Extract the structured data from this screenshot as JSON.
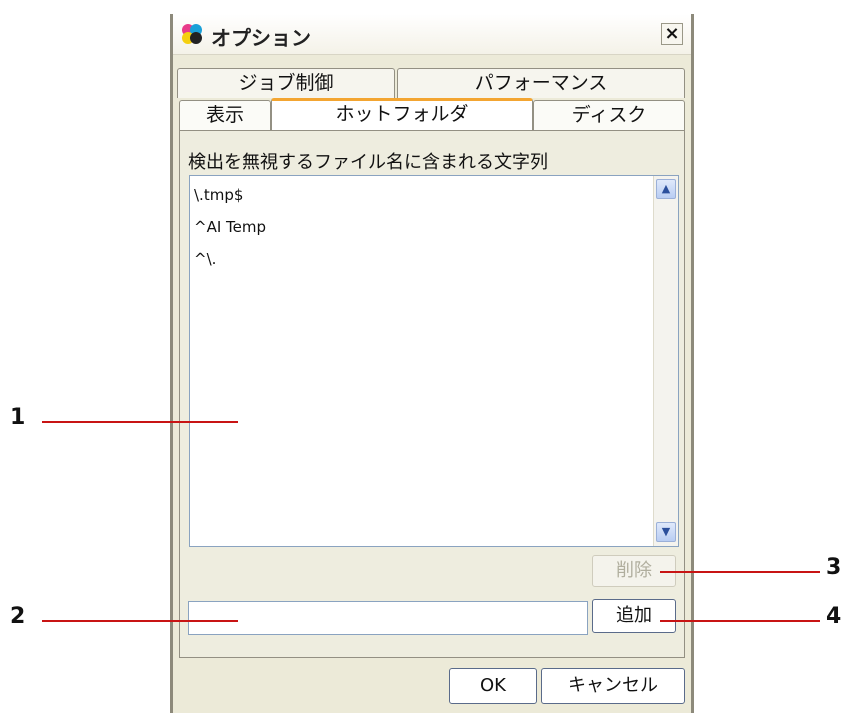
{
  "dialog": {
    "title": "オプション",
    "close_glyph": "×"
  },
  "tabs": {
    "back_row": [
      {
        "label": "ジョブ制御"
      },
      {
        "label": "パフォーマンス"
      }
    ],
    "front_row": [
      {
        "label": "表示"
      },
      {
        "label": "ホットフォルダ",
        "active": true
      },
      {
        "label": "ディスク"
      }
    ]
  },
  "panel": {
    "list_label": "検出を無視するファイル名に含まれる文字列",
    "list_items": [
      "\\.tmp$",
      "^AI Temp",
      "^\\."
    ],
    "delete_label": "削除",
    "add_label": "追加",
    "input_value": ""
  },
  "footer": {
    "ok_label": "OK",
    "cancel_label": "キャンセル"
  },
  "callouts": [
    "1",
    "2",
    "3",
    "4"
  ],
  "colors": {
    "accent_tab": "#f3a531",
    "callout_line": "#c81414"
  }
}
